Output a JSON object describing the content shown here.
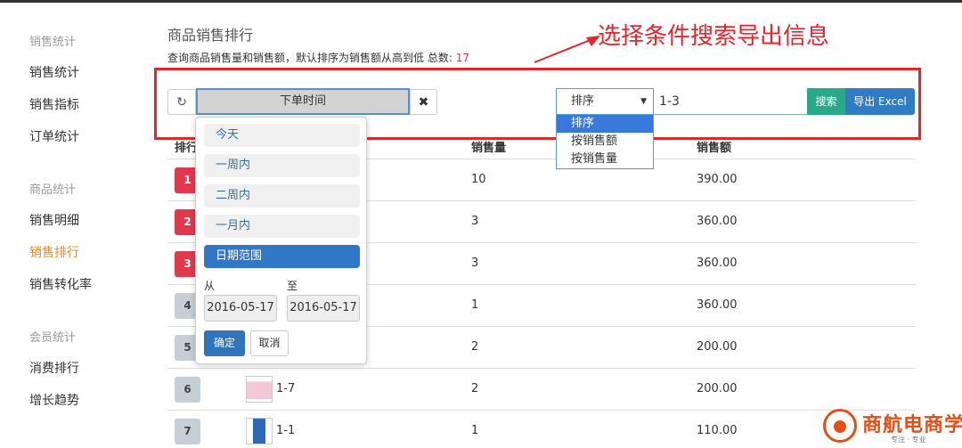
{
  "sidebar": {
    "groups": [
      {
        "label": "销售统计",
        "items": [
          "销售统计",
          "销售指标",
          "订单统计"
        ]
      },
      {
        "label": "商品统计",
        "items": [
          "销售明细",
          "销售排行",
          "销售转化率"
        ]
      },
      {
        "label": "会员统计",
        "items": [
          "消费排行",
          "增长趋势"
        ]
      }
    ],
    "active_item": "销售排行"
  },
  "header": {
    "title": "商品销售排行",
    "description": "查询商品销售量和销售额，默认排序为销售额从高到低 总数:",
    "total_count": "17"
  },
  "annotation": {
    "text": "选择条件搜索导出信息",
    "color": "#e8242b"
  },
  "toolbar": {
    "refresh_icon": "refresh-icon",
    "date_field_label": "下单时间",
    "clear_icon": "close-icon",
    "sort_select": {
      "selected": "排序",
      "options": [
        "排序",
        "按销售额",
        "按销售量"
      ]
    },
    "search_value": "1-3",
    "search_label": "搜索",
    "export_label": "导出 Excel"
  },
  "date_popup": {
    "ranges": [
      "今天",
      "一周内",
      "二周内",
      "一月内",
      "日期范围"
    ],
    "active_range": "日期范围",
    "from_label": "从",
    "to_label": "至",
    "from_value": "2016-05-17",
    "to_value": "2016-05-17",
    "ok_label": "确定",
    "cancel_label": "取消"
  },
  "table": {
    "headers": {
      "rank": "排行",
      "qty": "销售量",
      "amount": "销售额"
    },
    "rows": [
      {
        "rank": "1",
        "product": "",
        "qty": "10",
        "amount": "390.00"
      },
      {
        "rank": "2",
        "product": "",
        "qty": "3",
        "amount": "360.00"
      },
      {
        "rank": "3",
        "product": "",
        "qty": "3",
        "amount": "360.00"
      },
      {
        "rank": "4",
        "product": "",
        "qty": "1",
        "amount": "360.00"
      },
      {
        "rank": "5",
        "product": "",
        "qty": "2",
        "amount": "200.00"
      },
      {
        "rank": "6",
        "product": "1-7",
        "qty": "2",
        "amount": "200.00"
      },
      {
        "rank": "7",
        "product": "1-1",
        "qty": "1",
        "amount": "110.00"
      }
    ]
  },
  "logo": {
    "text": "商航电商学院",
    "sub": "专注 · 专业"
  },
  "colors": {
    "accent": "#e8891d",
    "danger": "#e0394e",
    "primary": "#2f7bc4",
    "success": "#2aa88a"
  }
}
